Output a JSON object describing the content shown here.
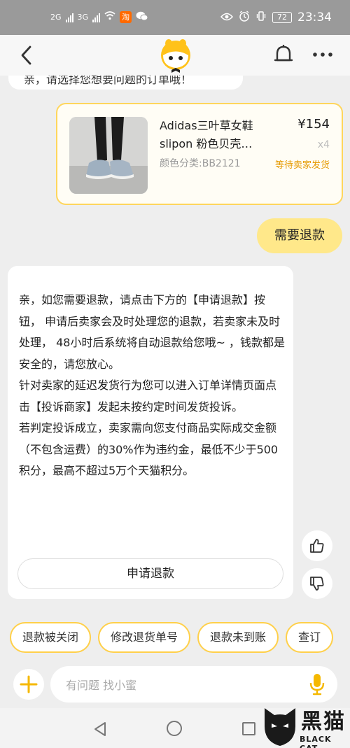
{
  "status_bar": {
    "signal1": "2G",
    "signal2": "3G",
    "taobao_badge": "淘",
    "battery": "72",
    "time": "23:34"
  },
  "previous_message": {
    "text": "亲，请选择您想要问题的订单哦！"
  },
  "order_card": {
    "title": "Adidas三叶草女鞋slipon 粉色贝壳…",
    "color_spec": "颜色分类:BB2121",
    "price": "¥154",
    "quantity": "x4",
    "status": "等待卖家发货"
  },
  "user_message": {
    "text": "需要退款"
  },
  "bot_reply": {
    "text": "亲，如您需要退款，请点击下方的【申请退款】按钮， 申请后卖家会及时处理您的退款，若卖家未及时处理， 48小时后系统将自动退款给您哦~ ，钱款都是安全的，请您放心。\n针对卖家的延迟发货行为您可以进入订单详情页面点击【投诉商家】发起未按约定时间发货投诉。\n若判定投诉成立，卖家需向您支付商品实际成交金额（不包含运费）的30%作为违约金，最低不少于500积分，最高不超过5万个天猫积分。",
    "action_label": "申请退款"
  },
  "quick_replies": [
    "退款被关闭",
    "修改退货单号",
    "退款未到账",
    "查订"
  ],
  "input": {
    "placeholder": "有问题 找小蜜"
  },
  "watermark": {
    "name": "黑猫",
    "sub": "BLACK CAT"
  },
  "colors": {
    "accent_yellow": "#ffd65c",
    "user_bubble": "#ffe88a",
    "status_orange": "#e69a00",
    "status_bar_bg": "#9a9a9a"
  }
}
